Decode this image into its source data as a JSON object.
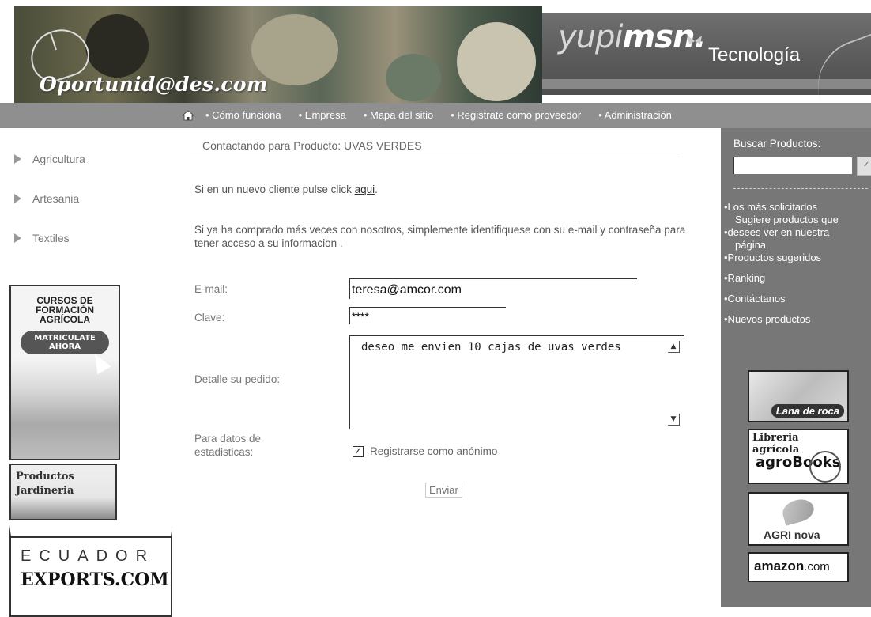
{
  "banner": {
    "logo_text": "Oportunid@des.com",
    "msn_yupi": "yupi",
    "msn_msn": "msn.",
    "msn_section": "Tecnología"
  },
  "nav": {
    "items": [
      "Cómo funciona",
      "Empresa",
      "Mapa del sitio",
      "Registrate como proveedor",
      "Administración"
    ]
  },
  "categories": [
    "Agricultura",
    "Artesania",
    "Textiles"
  ],
  "ads_left": {
    "cursos_line1": "CURSOS DE",
    "cursos_line2": "FORMACIÓN",
    "cursos_line3": "AGRÍCOLA",
    "cursos_button_line1": "MATRICULATE",
    "cursos_button_line2": "AHORA",
    "jardin_line1": "Productos",
    "jardin_line2": "Jardineria",
    "ecuador_line1": "ECUADOR",
    "ecuador_line2": "EXPORTS.COM"
  },
  "main": {
    "title": "Contactando para Producto:  UVAS VERDES",
    "new_client_text": "Si en un nuevo cliente pulse click ",
    "new_client_link": "aqui",
    "new_client_end": ".",
    "returning_text": "Si ya ha comprado más veces con nosotros, simplemente identifiquese con su e-mail y contraseña para tener acceso a su informacion .",
    "email_label": "E-mail:",
    "email_value": "teresa@amcor.com",
    "password_label": "Clave:",
    "password_value": "****",
    "detail_label": "Detalle su pedido:",
    "detail_value": "deseo me envien 10 cajas de uvas verdes",
    "stats_label_line1": "Para datos de",
    "stats_label_line2": "estadisticas:",
    "checkbox_label": "Registrarse como anónimo",
    "checkbox_checked": true,
    "submit_label": "Enviar"
  },
  "right": {
    "search_label": "Buscar Productos:",
    "search_value": "",
    "links": [
      "•Los más solicitados",
      "Sugiere productos que",
      "•desees ver en nuestra",
      "página",
      "•Productos sugeridos",
      "•Ranking",
      "•Contáctanos",
      "•Nuevos productos"
    ],
    "ad_lana": "Lana de roca",
    "ad_libreria_title": "Libreria agrícola",
    "ad_libreria_logo": "agroBooks",
    "ad_agri": "AGRI nova",
    "ad_amazon_bold": "amazon",
    "ad_amazon_tld": ".com"
  },
  "colors": {
    "nav_bg": "#8f8f8f",
    "right_bg": "#777777",
    "msn_bg": "#5a5a5a"
  }
}
